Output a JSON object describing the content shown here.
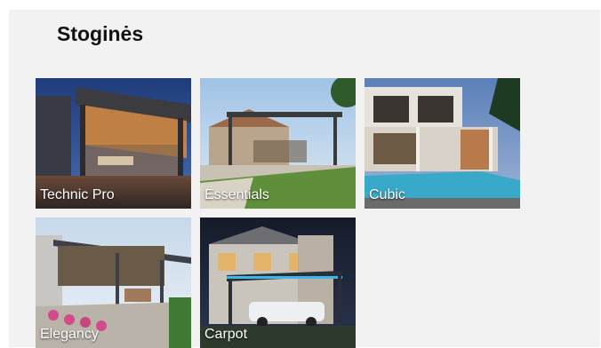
{
  "page": {
    "title": "Stoginės"
  },
  "products": [
    {
      "label": "Technic Pro"
    },
    {
      "label": "Essentials"
    },
    {
      "label": "Cubic"
    },
    {
      "label": "Elegancy"
    },
    {
      "label": "Carpot"
    }
  ]
}
